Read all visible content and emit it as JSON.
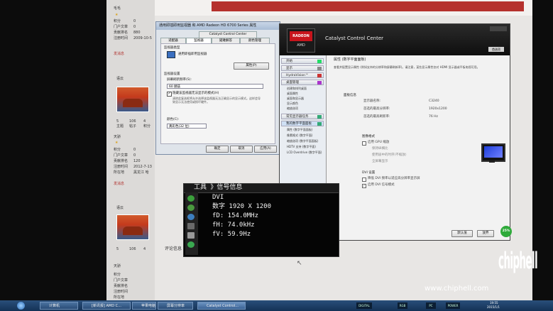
{
  "forum": {
    "top_user": "毛毛",
    "stats1": [
      "积分",
      "门户文章",
      "贡献排名",
      "注册时间"
    ],
    "stats1_vals": [
      "0",
      "0",
      "880",
      "2009-10-5"
    ],
    "send_msg": "发消息",
    "post_label": "语云",
    "thumb_stats": [
      "5",
      "106",
      "4"
    ],
    "thumb_caps": [
      "主题",
      "帖子",
      "积分"
    ],
    "user2": "天骄",
    "stats2": [
      "积分",
      "门户文章",
      "贡献排名",
      "注册时间",
      "所在地"
    ],
    "stats2_vals": [
      "0",
      "0",
      "120",
      "2012-7-13",
      "黑龙江 哈"
    ],
    "user3_label": "语云",
    "reply_hint": "评论信息"
  },
  "display_dialog": {
    "title": "通用即插即用监视器 和 AMD Radeon HD 6700 Series 属性",
    "tabs": [
      "适配器",
      "监视器",
      "疑难解答",
      "颜色管理",
      "Catalyst Control Center"
    ],
    "monitor_type_label": "监视器类型",
    "monitor_name": "通用即插即用监视器",
    "properties_btn": "属性(P)",
    "settings_label": "监视器设置",
    "refresh_label": "屏幕刷新频率(S):",
    "refresh_value": "60 赫兹",
    "hide_modes_text": "隐藏该监视器无法显示的模式(H)",
    "hide_modes_note": "清除此复选框将允许选择该监视器无法正确显示的显示模式。这样会导致显示无法使用或损坏硬件。",
    "colors_label": "颜色(C):",
    "colors_value": "真彩色(32 位)",
    "ok_btn": "确定",
    "cancel_btn": "取消",
    "apply_btn": "应用(A)"
  },
  "ccc": {
    "app_title": "Catalyst Control Center",
    "brand_top": "RADEON",
    "brand_bottom": "AMD",
    "prefs_btn": "首选项",
    "sidebar": [
      {
        "label": "开始"
      },
      {
        "label": "显示"
      },
      {
        "label": "HydraVision™"
      },
      {
        "label": "桌面管理"
      },
      {
        "label": "常见显示器任务"
      },
      {
        "label": "我的数字平面面板"
      },
      {
        "label": "视频"
      },
      {
        "label": "游戏"
      }
    ],
    "sub_desktop": [
      "创建和排列桌面",
      "桌面属性",
      "桌面和显示器",
      "显示颜色",
      "缩放选项"
    ],
    "sub_digital": [
      "属性 (数字平面面板)",
      "像素格式 (数字平面)",
      "缩放选项 (数字平面面板)",
      "HDTV 支持 (数字平面)",
      "LCD Overdrive (数字平面)"
    ],
    "main": {
      "page_title": "属性 (数字平面面板)",
      "desc": "查看并配置显示属性 (例如支持的分辨率和屏幕刷新率)。请注意，某些显示属性仅对 HDMI 显示器或平板电视可用。",
      "section_info": "面板信息",
      "rows": [
        {
          "k": "显示器名称:",
          "v": "C3240"
        },
        {
          "k": "首选的最高分辨率:",
          "v": "1920x1200"
        },
        {
          "k": "首选的最高刷新率:",
          "v": "76 Hz"
        }
      ],
      "section_img": "图像格式",
      "gpu_scaling": "启用 GPU 缩放",
      "scale_opt1": "保持纵横比",
      "scale_opt2": "使用居中的时序(不缩放)",
      "scale_opt3": "全屏幕显示",
      "dvi_section": "DVI 设置",
      "dvi_opt1": "降低 DVI 频率以适应高分辨率显示屏",
      "dvi_opt2": "启用 DVI 信号模式",
      "defaults_btn": "默认值",
      "discard_btn": "放弃",
      "apply_btn": "应用"
    }
  },
  "osd": {
    "title": "工具 》信号信息",
    "lines": [
      {
        "text": "DVI"
      },
      {
        "text": "数字          1920 X 1200"
      },
      {
        "text": "fD: 154.0MHz"
      },
      {
        "text": "fH:  74.0kHz"
      },
      {
        "text": "fV:  59.9Hz"
      }
    ]
  },
  "taskbar": {
    "items": [
      "计算机",
      "[新讯报] AMD C...",
      "苹果电脑",
      "屏幕分辨率",
      "Catalyst Control..."
    ],
    "tray_labels": [
      "DIGITAL",
      "RGB",
      "PC",
      "POWER"
    ],
    "clock_time": "19:55",
    "clock_date": "2015/1/1",
    "progress_text": "25%",
    "progress_fraction": 0.25
  },
  "watermark": {
    "brand": "chiphell",
    "url": "www.chiphell.com"
  },
  "colors": {
    "ccc_accent": "#c8141c",
    "forum_accent": "#b5312d",
    "osd_bg": "#050505"
  }
}
